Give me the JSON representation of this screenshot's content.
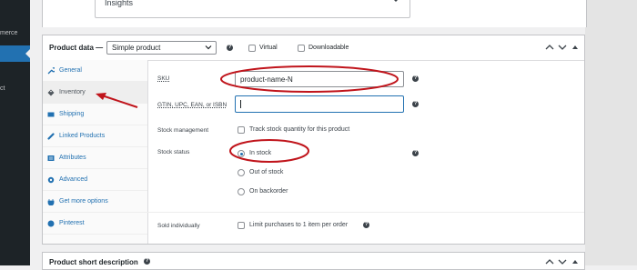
{
  "admin_sidebar": {
    "menu_fragment_1": "merce",
    "menu_fragment_2": "ct"
  },
  "insights": {
    "label": "Insights"
  },
  "product_data": {
    "title": "Product data —",
    "type_select": "Simple product",
    "virtual_label": "Virtual",
    "downloadable_label": "Downloadable",
    "tabs": [
      {
        "label": "General",
        "icon": "wrench-icon"
      },
      {
        "label": "Inventory",
        "icon": "tag-icon"
      },
      {
        "label": "Shipping",
        "icon": "truck-icon"
      },
      {
        "label": "Linked Products",
        "icon": "link-icon"
      },
      {
        "label": "Attributes",
        "icon": "list-icon"
      },
      {
        "label": "Advanced",
        "icon": "gear-icon"
      },
      {
        "label": "Get more options",
        "icon": "plugin-icon"
      },
      {
        "label": "Pinterest",
        "icon": "pinterest-icon"
      }
    ],
    "active_tab": "Inventory",
    "fields": {
      "sku_label": "SKU",
      "sku_value": "product-name-N",
      "gtin_label": "GTIN, UPC, EAN, or ISBN",
      "gtin_value": "",
      "stock_management_label": "Stock management",
      "stock_management_option": "Track stock quantity for this product",
      "stock_status_label": "Stock status",
      "stock_status_options": [
        "In stock",
        "Out of stock",
        "On backorder"
      ],
      "stock_status_selected": "In stock",
      "sold_individually_label": "Sold individually",
      "sold_individually_option": "Limit purchases to 1 item per order"
    }
  },
  "product_short_description": {
    "title": "Product short description"
  },
  "colors": {
    "accent": "#2271b1",
    "annotation": "#c0141b"
  }
}
